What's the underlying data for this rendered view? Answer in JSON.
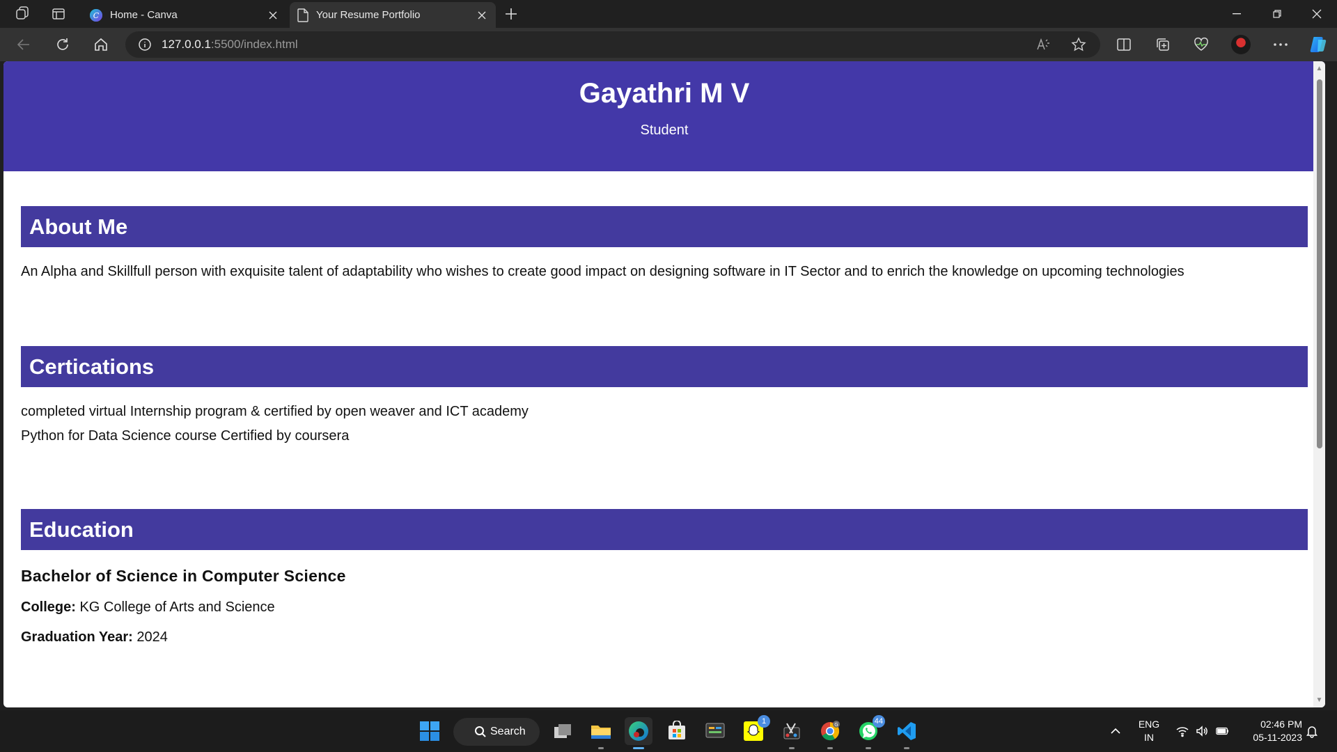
{
  "browser": {
    "tabs": [
      {
        "title": "Home - Canva",
        "icon": "canva-icon",
        "active": false
      },
      {
        "title": "Your Resume Portfolio",
        "icon": "page-icon",
        "active": true
      }
    ],
    "url_host": "127.0.0.1",
    "url_path": ":5500/index.html"
  },
  "page": {
    "header": {
      "name": "Gayathri M V",
      "role": "Student"
    },
    "about": {
      "heading": "About Me",
      "text": "An Alpha and Skillfull person with exquisite talent of adaptability who wishes to create good impact on designing software in IT Sector and to enrich the knowledge on upcoming technologies"
    },
    "certifications": {
      "heading": "Certications",
      "items": [
        "completed virtual Internship program & certified by open weaver and ICT academy",
        "Python for Data Science course Certified by coursera"
      ]
    },
    "education": {
      "heading": "Education",
      "degree": "Bachelor of Science in Computer Science",
      "college_label": "College:",
      "college": "KG College of Arts and Science",
      "year_label": "Graduation Year:",
      "year": "2024"
    },
    "colors": {
      "accent": "#4338a8",
      "section": "#433a9e"
    }
  },
  "taskbar": {
    "search_label": "Search",
    "snapchat_badge": "1",
    "whatsapp_badge": "44",
    "lang_top": "ENG",
    "lang_bottom": "IN",
    "time": "02:46 PM",
    "date": "05-11-2023"
  }
}
